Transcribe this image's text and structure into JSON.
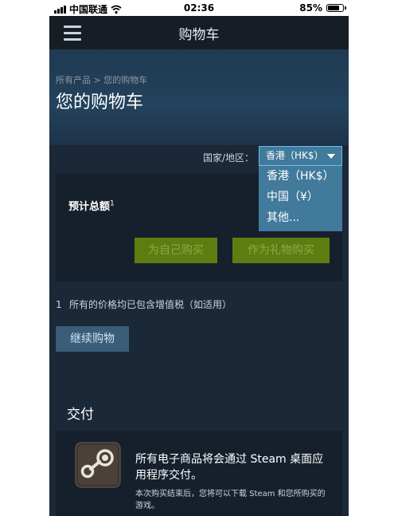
{
  "status_bar": {
    "carrier": "中国联通",
    "time": "02:36",
    "battery": "85%",
    "battery_level": 0.85
  },
  "header": {
    "title": "购物车"
  },
  "breadcrumb": {
    "root": "所有产品",
    "separator": " > ",
    "current": "您的购物车"
  },
  "page_title": "您的购物车",
  "country": {
    "label": "国家/地区：",
    "selected": "香港（HK$）",
    "options": [
      "香港（HK$）",
      "中国（¥）",
      "其他..."
    ]
  },
  "cart": {
    "total_label": "预计总额",
    "total_sup": "1",
    "buy_self": "为自己购买",
    "buy_gift": "作为礼物购买"
  },
  "footnote": {
    "number": "1",
    "text": "所有的价格均已包含增值税（如适用）"
  },
  "continue_shopping": "继续购物",
  "delivery": {
    "heading": "交付",
    "main": "所有电子商品将会通过 Steam 桌面应用程序交付。",
    "sub": "本次购买结束后，您将可以下载 Steam 和您所购买的游戏。"
  }
}
